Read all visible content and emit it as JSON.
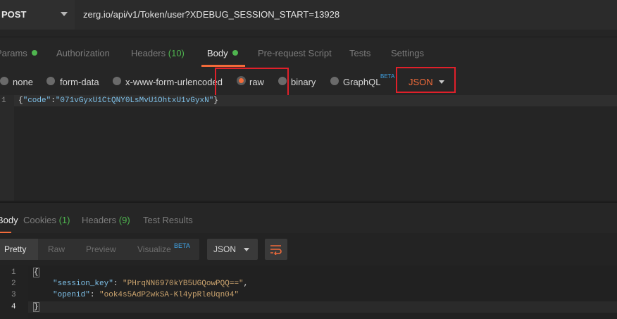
{
  "request": {
    "method": "POST",
    "url": "zerg.io/api/v1/Token/user?XDEBUG_SESSION_START=13928",
    "tabs": {
      "params": "Params",
      "authorization": "Authorization",
      "headers": "Headers",
      "headers_count": "(10)",
      "body": "Body",
      "prerequest": "Pre-request Script",
      "tests": "Tests",
      "settings": "Settings"
    },
    "body_types": {
      "none": "none",
      "form_data": "form-data",
      "urlencoded": "x-www-form-urlencoded",
      "raw": "raw",
      "binary": "binary",
      "graphql": "GraphQL",
      "graphql_badge": "BETA"
    },
    "selected_body_type": "raw",
    "content_type": "JSON",
    "editor": {
      "line_number": "1",
      "open_brace": "{",
      "key": "\"code\"",
      "colon": ":",
      "value": "\"071vGyxU1CtQNY0LsMvU1OhtxU1vGyxN\"",
      "close_brace": "}"
    }
  },
  "response": {
    "tabs": {
      "body": "Body",
      "cookies": "Cookies",
      "cookies_count": "(1)",
      "headers": "Headers",
      "headers_count": "(9)",
      "test_results": "Test Results"
    },
    "views": {
      "pretty": "Pretty",
      "raw": "Raw",
      "preview": "Preview",
      "visualize": "Visualize",
      "visualize_badge": "BETA"
    },
    "format": "JSON",
    "lines": [
      {
        "n": "1",
        "text": "{"
      },
      {
        "n": "2",
        "key": "\"session_key\"",
        "value": "\"PHrqNN6970kYB5UGQowPQQ==\"",
        "trail": ","
      },
      {
        "n": "3",
        "key": "\"openid\"",
        "value": "\"ook4s5AdP2wkSA-Kl4ypRleUqn04\"",
        "trail": ""
      },
      {
        "n": "4",
        "text": "}"
      }
    ]
  },
  "colors": {
    "accent": "#f26b3a",
    "count_green": "#4fb54f",
    "badge_blue": "#3fa3e6",
    "highlight_red": "#e0202a"
  }
}
